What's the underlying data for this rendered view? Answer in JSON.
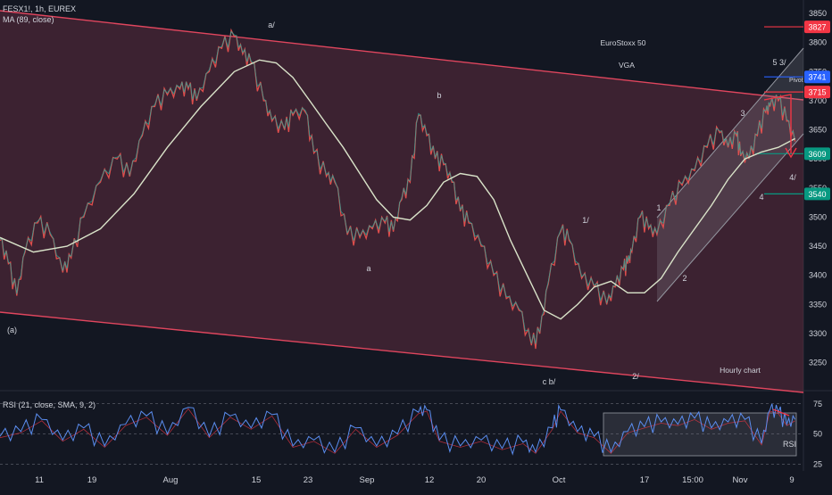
{
  "header": {
    "symbol_line": "FESX1!, 1h, EUREX",
    "ma_line": "MA (89, close)"
  },
  "rsi_panel": {
    "legend": "RSI (21, close, SMA, 9, 2)",
    "label": "RSI",
    "ticks": [
      "75",
      "50",
      "25"
    ]
  },
  "annotations": {
    "title": "EuroStoxx 50",
    "subtitle": "VGA",
    "pivot": "Pivot",
    "hourly": "Hourly chart",
    "wave_a_paren": "(a)",
    "wave_a_slash": "a/",
    "wave_b": "b",
    "wave_a": "a",
    "wave_cb": "c b/",
    "wave_1_slash": "1/",
    "wave_2_slash": "2/",
    "wave_1": "1",
    "wave_2": "2",
    "wave_3": "3",
    "wave_4": "4",
    "wave_4_slash": "4/",
    "wave_53": "5 3/"
  },
  "chart_data": {
    "type": "line",
    "instrument": "FESX1!",
    "timeframe": "1h",
    "exchange": "EUREX",
    "y_ticks": [
      3850,
      3800,
      3750,
      3700,
      3650,
      3600,
      3550,
      3500,
      3450,
      3400,
      3350,
      3300,
      3250
    ],
    "ylim": [
      3205,
      3870
    ],
    "x_tick_labels": [
      "11",
      "19",
      "Aug",
      "15",
      "23",
      "Sep",
      "12",
      "20",
      "Oct",
      "17",
      "15:00",
      "Nov",
      "9"
    ],
    "price_levels": [
      {
        "label": "3827",
        "value": 3827,
        "color": "#f23645"
      },
      {
        "label": "3741",
        "value": 3741,
        "color": "#2962ff"
      },
      {
        "label": "3715",
        "value": 3715,
        "color": "#f23645"
      },
      {
        "label": "3609",
        "value": 3609,
        "color": "#089981"
      },
      {
        "label": "3540",
        "value": 3540,
        "color": "#089981"
      }
    ],
    "price_path": [
      [
        0,
        3460
      ],
      [
        2,
        3420
      ],
      [
        4,
        3365
      ],
      [
        6,
        3440
      ],
      [
        9,
        3490
      ],
      [
        12,
        3470
      ],
      [
        15,
        3405
      ],
      [
        17,
        3430
      ],
      [
        20,
        3500
      ],
      [
        24,
        3560
      ],
      [
        28,
        3600
      ],
      [
        31,
        3570
      ],
      [
        34,
        3640
      ],
      [
        37,
        3690
      ],
      [
        40,
        3710
      ],
      [
        43,
        3720
      ],
      [
        45,
        3720
      ],
      [
        47,
        3700
      ],
      [
        50,
        3750
      ],
      [
        53,
        3790
      ],
      [
        56,
        3810
      ],
      [
        58,
        3780
      ],
      [
        60,
        3765
      ],
      [
        63,
        3700
      ],
      [
        65,
        3665
      ],
      [
        68,
        3650
      ],
      [
        70,
        3675
      ],
      [
        73,
        3680
      ],
      [
        75,
        3610
      ],
      [
        78,
        3570
      ],
      [
        80,
        3560
      ],
      [
        83,
        3470
      ],
      [
        86,
        3465
      ],
      [
        89,
        3480
      ],
      [
        92,
        3490
      ],
      [
        94,
        3475
      ],
      [
        96,
        3530
      ],
      [
        98,
        3560
      ],
      [
        100,
        3675
      ],
      [
        102,
        3640
      ],
      [
        104,
        3600
      ],
      [
        106,
        3590
      ],
      [
        108,
        3560
      ],
      [
        110,
        3510
      ],
      [
        112,
        3490
      ],
      [
        115,
        3450
      ],
      [
        118,
        3400
      ],
      [
        121,
        3360
      ],
      [
        124,
        3340
      ],
      [
        127,
        3280
      ],
      [
        129,
        3300
      ],
      [
        131,
        3385
      ],
      [
        134,
        3475
      ],
      [
        136,
        3460
      ],
      [
        139,
        3395
      ],
      [
        142,
        3380
      ],
      [
        145,
        3350
      ],
      [
        147,
        3380
      ],
      [
        149,
        3410
      ],
      [
        150,
        3420
      ],
      [
        151,
        3440
      ],
      [
        153,
        3500
      ],
      [
        155,
        3480
      ],
      [
        157,
        3470
      ],
      [
        160,
        3520
      ],
      [
        163,
        3555
      ],
      [
        166,
        3580
      ],
      [
        169,
        3620
      ],
      [
        172,
        3645
      ],
      [
        174,
        3620
      ],
      [
        176,
        3640
      ],
      [
        177,
        3605
      ],
      [
        179,
        3600
      ],
      [
        181,
        3640
      ],
      [
        183,
        3680
      ],
      [
        184,
        3690
      ],
      [
        186,
        3700
      ],
      [
        188,
        3665
      ],
      [
        190,
        3630
      ]
    ],
    "ma_path": [
      [
        0,
        3465
      ],
      [
        8,
        3440
      ],
      [
        16,
        3450
      ],
      [
        24,
        3480
      ],
      [
        32,
        3540
      ],
      [
        40,
        3620
      ],
      [
        48,
        3690
      ],
      [
        56,
        3750
      ],
      [
        62,
        3770
      ],
      [
        66,
        3765
      ],
      [
        70,
        3740
      ],
      [
        74,
        3700
      ],
      [
        78,
        3660
      ],
      [
        82,
        3620
      ],
      [
        86,
        3575
      ],
      [
        90,
        3530
      ],
      [
        94,
        3500
      ],
      [
        98,
        3495
      ],
      [
        102,
        3520
      ],
      [
        106,
        3560
      ],
      [
        110,
        3575
      ],
      [
        114,
        3570
      ],
      [
        118,
        3530
      ],
      [
        122,
        3460
      ],
      [
        126,
        3400
      ],
      [
        130,
        3340
      ],
      [
        134,
        3325
      ],
      [
        138,
        3350
      ],
      [
        142,
        3380
      ],
      [
        146,
        3390
      ],
      [
        150,
        3370
      ],
      [
        154,
        3370
      ],
      [
        158,
        3395
      ],
      [
        162,
        3440
      ],
      [
        166,
        3480
      ],
      [
        170,
        3520
      ],
      [
        174,
        3565
      ],
      [
        178,
        3600
      ],
      [
        182,
        3612
      ],
      [
        186,
        3620
      ],
      [
        190,
        3635
      ]
    ],
    "rsi_ylim": [
      20,
      80
    ],
    "rsi_levels": [
      75,
      50,
      25
    ],
    "rsi_path": [
      [
        0,
        48
      ],
      [
        5,
        52
      ],
      [
        10,
        62
      ],
      [
        15,
        45
      ],
      [
        20,
        55
      ],
      [
        25,
        40
      ],
      [
        30,
        58
      ],
      [
        35,
        65
      ],
      [
        40,
        50
      ],
      [
        45,
        72
      ],
      [
        50,
        48
      ],
      [
        55,
        65
      ],
      [
        60,
        55
      ],
      [
        65,
        66
      ],
      [
        70,
        40
      ],
      [
        75,
        45
      ],
      [
        80,
        35
      ],
      [
        85,
        55
      ],
      [
        90,
        40
      ],
      [
        95,
        50
      ],
      [
        100,
        68
      ],
      [
        102,
        70
      ],
      [
        105,
        45
      ],
      [
        110,
        40
      ],
      [
        115,
        45
      ],
      [
        120,
        38
      ],
      [
        125,
        43
      ],
      [
        128,
        35
      ],
      [
        132,
        55
      ],
      [
        134,
        70
      ],
      [
        138,
        52
      ],
      [
        142,
        48
      ],
      [
        146,
        35
      ],
      [
        150,
        52
      ],
      [
        154,
        56
      ],
      [
        158,
        60
      ],
      [
        162,
        58
      ],
      [
        166,
        63
      ],
      [
        170,
        55
      ],
      [
        174,
        60
      ],
      [
        178,
        62
      ],
      [
        182,
        42
      ],
      [
        184,
        70
      ],
      [
        186,
        68
      ],
      [
        188,
        58
      ],
      [
        190,
        62
      ]
    ]
  },
  "colors": {
    "background": "#131722",
    "channel_fill": "#5e2c3e",
    "channel_line": "#e0465e",
    "up_channel": "#9598a1",
    "ma_line": "#d9e3c9",
    "price_up": "#26a69a",
    "price_down": "#ef5350",
    "rsi_line": "#5b8def",
    "rsi_signal": "#f23645",
    "text": "#d1d4dc"
  }
}
